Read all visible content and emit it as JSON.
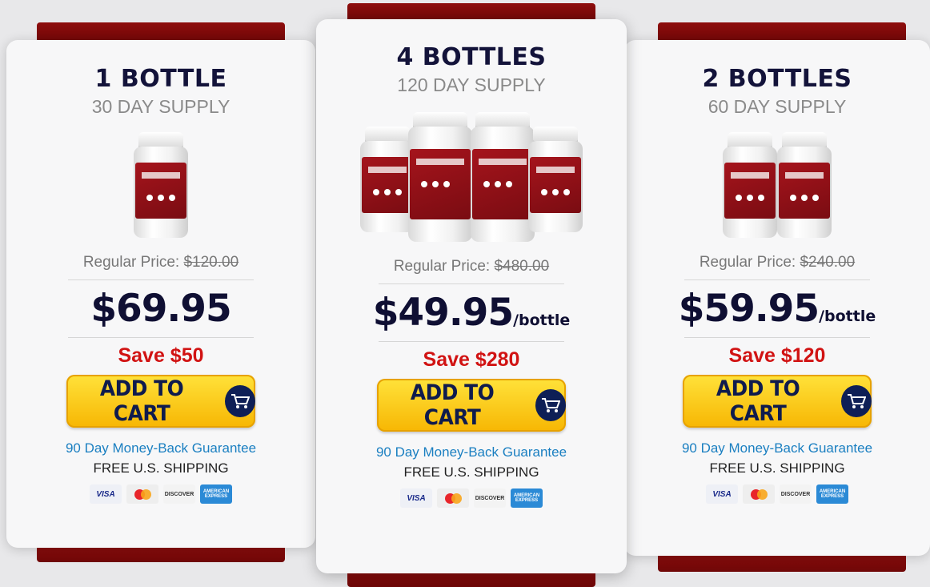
{
  "cards": [
    {
      "title": "1 BOTTLE",
      "subtitle": "30 DAY SUPPLY",
      "bottle_count": 1,
      "regular_label": "Regular Price:",
      "regular_price": "$120.00",
      "price": "$69.95",
      "per_unit": "",
      "save": "Save $50",
      "cart_label": "ADD TO CART",
      "guarantee": "90 Day Money-Back Guarantee",
      "shipping": "FREE U.S. SHIPPING"
    },
    {
      "title": "4 BOTTLES",
      "subtitle": "120 DAY SUPPLY",
      "bottle_count": 4,
      "regular_label": "Regular Price:",
      "regular_price": "$480.00",
      "price": "$49.95",
      "per_unit": "/bottle",
      "save": "Save $280",
      "cart_label": "ADD TO CART",
      "guarantee": "90 Day Money-Back Guarantee",
      "shipping": "FREE U.S. SHIPPING"
    },
    {
      "title": "2 BOTTLES",
      "subtitle": "60 DAY SUPPLY",
      "bottle_count": 2,
      "regular_label": "Regular Price:",
      "regular_price": "$240.00",
      "price": "$59.95",
      "per_unit": "/bottle",
      "save": "Save $120",
      "cart_label": "ADD TO CART",
      "guarantee": "90 Day Money-Back Guarantee",
      "shipping": "FREE U.S. SHIPPING"
    }
  ],
  "payment_methods": {
    "visa": "VISA",
    "discover": "DISCOVER",
    "amex": "AMERICAN EXPRESS"
  },
  "colors": {
    "band": "#7a0a0a",
    "price": "#0f0f33",
    "save": "#d11313",
    "guarantee": "#1a7fc1",
    "button": "#f7b603"
  },
  "icons": {
    "cart": "shopping-cart-icon",
    "product": "supplement-bottle-icon"
  }
}
